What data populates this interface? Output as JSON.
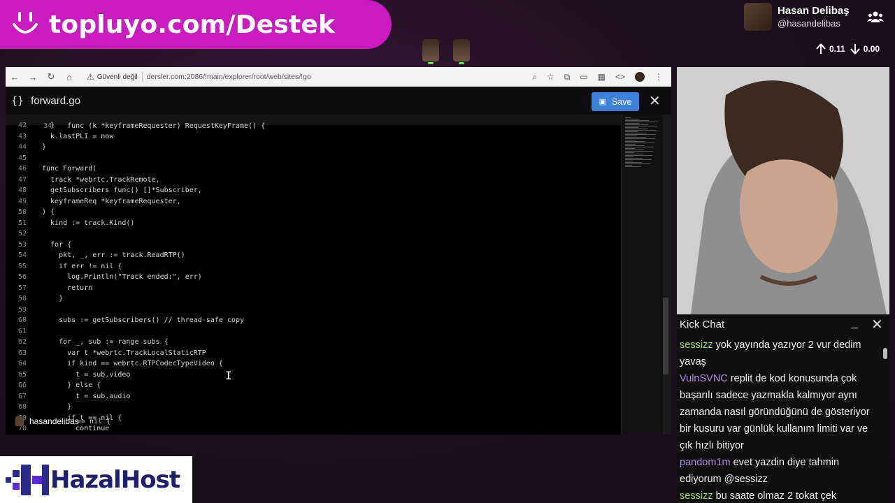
{
  "banner": {
    "text": "topluyo.com/Destek"
  },
  "streamer": {
    "name": "Hasan Delibaş",
    "handle": "@hasandelibas"
  },
  "stats": {
    "up": "0.11",
    "down": "0.00"
  },
  "browser": {
    "security_warning": "Güvenli değil",
    "url": "dersler.com:2086/!main/explorer/root/web/sites/!go"
  },
  "editor": {
    "file_name": "forward.go",
    "save_label": "Save",
    "sticky": {
      "num": "34",
      "text": "func (k *keyframeRequester) RequestKeyFrame() {"
    },
    "lines": [
      {
        "num": "42",
        "text": "  }"
      },
      {
        "num": "43",
        "text": "  k.lastPLI = now"
      },
      {
        "num": "44",
        "text": "}"
      },
      {
        "num": "45",
        "text": ""
      },
      {
        "num": "46",
        "text": "func Forward("
      },
      {
        "num": "47",
        "text": "  track *webrtc.TrackRemote,"
      },
      {
        "num": "48",
        "text": "  getSubscribers func() []*Subscriber,"
      },
      {
        "num": "49",
        "text": "  keyframeReq *keyframeRequester,"
      },
      {
        "num": "50",
        "text": ") {"
      },
      {
        "num": "51",
        "text": "  kind := track.Kind()"
      },
      {
        "num": "52",
        "text": ""
      },
      {
        "num": "53",
        "text": "  for {"
      },
      {
        "num": "54",
        "text": "    pkt, _, err := track.ReadRTP()"
      },
      {
        "num": "55",
        "text": "    if err != nil {"
      },
      {
        "num": "56",
        "text": "      log.Println(\"Track ended:\", err)"
      },
      {
        "num": "57",
        "text": "      return"
      },
      {
        "num": "58",
        "text": "    }"
      },
      {
        "num": "59",
        "text": ""
      },
      {
        "num": "60",
        "text": "    subs := getSubscribers() // thread-safe copy"
      },
      {
        "num": "61",
        "text": ""
      },
      {
        "num": "62",
        "text": "    for _, sub := range subs {"
      },
      {
        "num": "63",
        "text": "      var t *webrtc.TrackLocalStaticRTP"
      },
      {
        "num": "64",
        "text": "      if kind == webrtc.RTPCodecTypeVideo {"
      },
      {
        "num": "65",
        "text": "        t = sub.video"
      },
      {
        "num": "66",
        "text": "      } else {"
      },
      {
        "num": "67",
        "text": "        t = sub.audio"
      },
      {
        "num": "68",
        "text": "      }"
      },
      {
        "num": "69",
        "text": "      if t == nil {"
      },
      {
        "num": "70",
        "text": "        continue"
      }
    ],
    "cam_user": "hasandelibas",
    "ghost_code": "== nil {"
  },
  "chat": {
    "title": "Kick Chat",
    "messages": [
      {
        "user": "sessizz",
        "color": "#9ad86a",
        "text": "yok yayında yazıyor 2 vur dedim yavaş"
      },
      {
        "user": "VulnSVNC",
        "color": "#b28be6",
        "text": "replit de kod konusunda çok başarılı sadece yazmakla kalmıyor aynı zamanda nasıl göründüğünü de gösteriyor bir kusuru var günlük kullanım limiti var ve çık hızlı bitiyor"
      },
      {
        "user": "pandom1m",
        "color": "#b28be6",
        "text": "evet yazdin diye tahmin ediyorum @sessizz"
      },
      {
        "user": "sessizz",
        "color": "#9ad86a",
        "text": "bu saate olmaz 2 tokat çek"
      }
    ]
  },
  "sponsor": {
    "text": "HazalHost"
  }
}
